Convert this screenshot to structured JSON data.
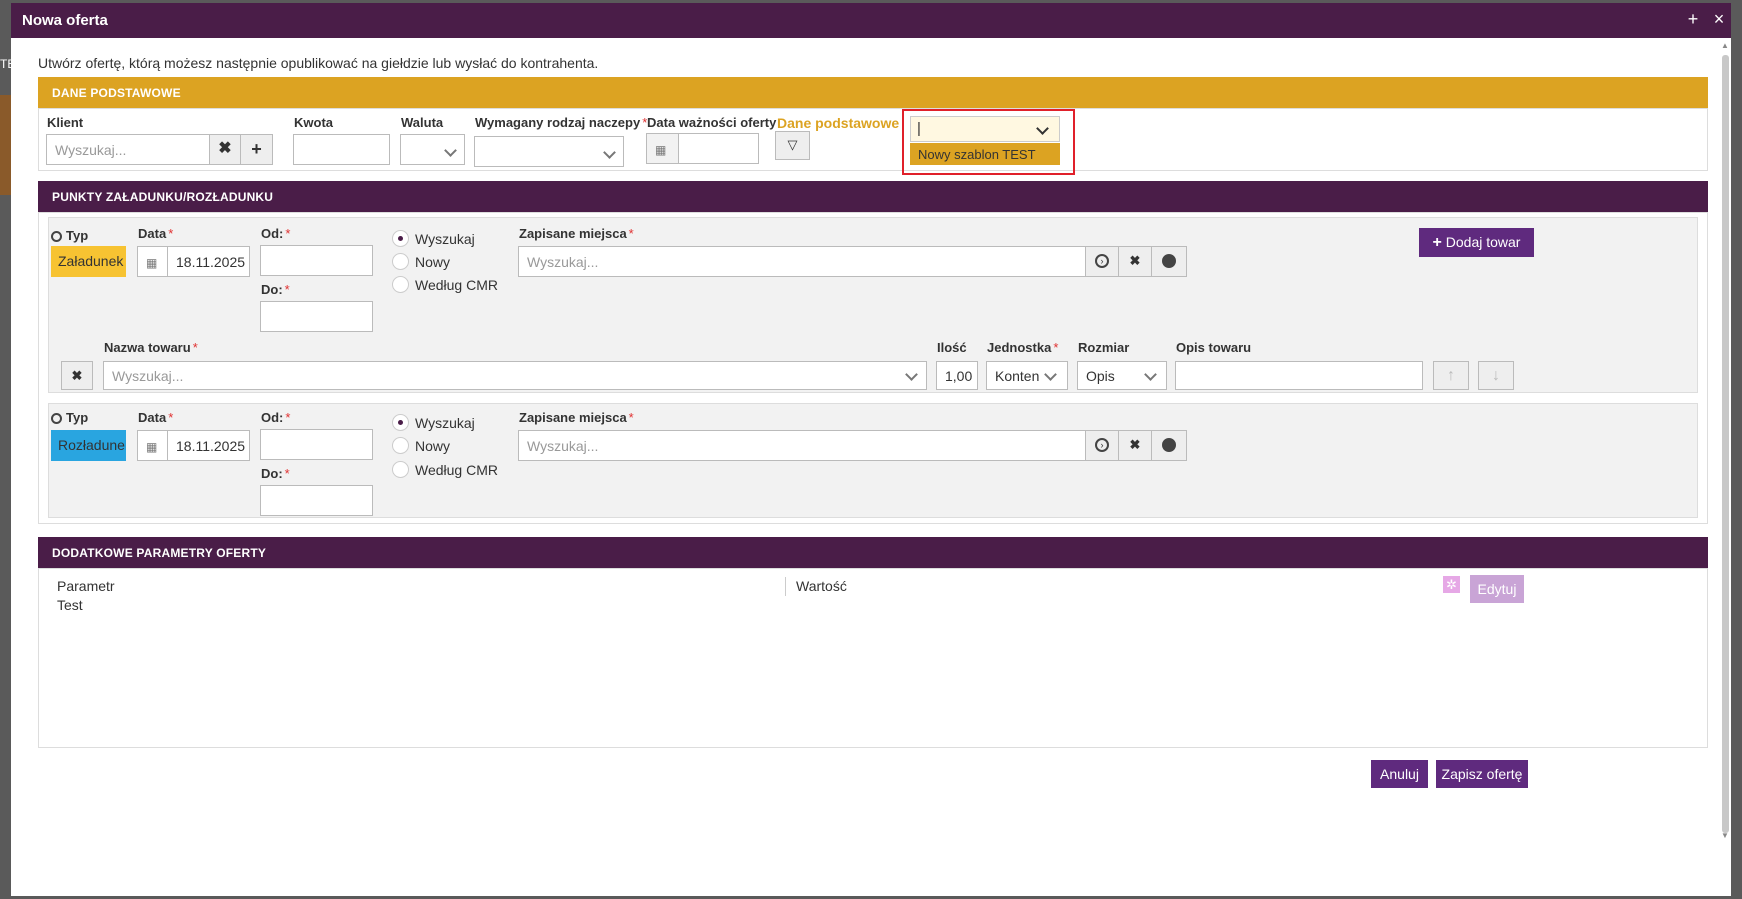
{
  "dialog": {
    "title": "Nowa oferta",
    "add_icon": "+",
    "close_icon": "×"
  },
  "intro": "Utwórz ofertę, którą możesz następnie opublikować na giełdzie lub wysłać do kontrahenta.",
  "section_basic": {
    "header": "DANE PODSTAWOWE",
    "client_label": "Klient",
    "client_placeholder": "Wyszukaj...",
    "amount_label": "Kwota",
    "currency_label": "Waluta",
    "trailer_label": "Wymagany rodzaj naczepy",
    "validity_label": "Data ważności oferty",
    "template_link": "Dane podstawowe",
    "template_dropdown_value": "|",
    "template_dropdown_option": "Nowy szablon TEST"
  },
  "section_points": {
    "header": "PUNKTY ZAŁADUNKU/ROZŁADUNKU",
    "type_label": "Typ",
    "date_label": "Data",
    "from_label": "Od:",
    "to_label": "Do:",
    "saved_places_label": "Zapisane miejsca",
    "search_placeholder": "Wyszukaj...",
    "radio_search": "Wyszukaj",
    "radio_new": "Nowy",
    "radio_cmr": "Według CMR",
    "add_goods_button": "Dodaj towar",
    "loading": {
      "type": "Załadunek",
      "date": "18.11.2025",
      "color": "#f7c332"
    },
    "unloading": {
      "type": "Rozładunek",
      "date": "18.11.2025",
      "color": "#29a5e0"
    },
    "goods": {
      "name_label": "Nazwa towaru",
      "name_placeholder": "Wyszukaj...",
      "qty_label": "Ilość",
      "qty_value": "1,00",
      "unit_label": "Jednostka",
      "unit_value": "Konten",
      "size_label": "Rozmiar",
      "size_value": "Opis",
      "desc_label": "Opis towaru"
    }
  },
  "section_params": {
    "header": "DODATKOWE PARAMETRY OFERTY",
    "col_param": "Parametr",
    "col_value": "Wartość",
    "row_param": "Test",
    "edit_button": "Edytuj"
  },
  "footer": {
    "cancel_button": "Anuluj",
    "save_button": "Zapisz ofertę"
  },
  "colors": {
    "primary": "#4a1d48",
    "gold": "#dca322",
    "button": "#5f2a7e",
    "highlight": "#e0202a"
  },
  "partial_left_text": "TE"
}
